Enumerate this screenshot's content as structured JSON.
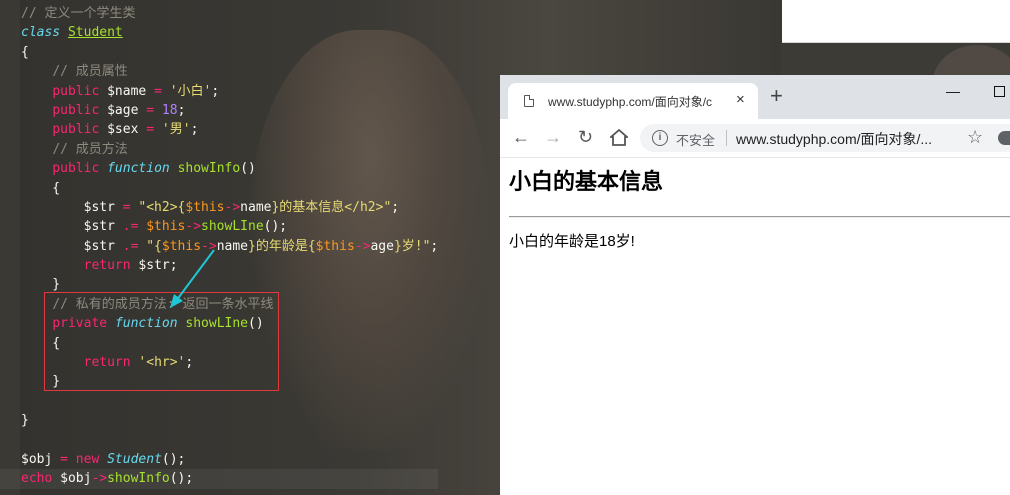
{
  "editor": {
    "lines": [
      [
        {
          "t": "// 定义一个学生类",
          "c": "c-com"
        }
      ],
      [
        {
          "t": "class",
          "c": "c-it"
        },
        {
          "t": " "
        },
        {
          "t": "Student",
          "c": "c-cls"
        }
      ],
      [
        {
          "t": "{"
        }
      ],
      [
        {
          "t": "    "
        },
        {
          "t": "// 成员属性",
          "c": "c-com"
        }
      ],
      [
        {
          "t": "    "
        },
        {
          "t": "public",
          "c": "c-kw"
        },
        {
          "t": " $name "
        },
        {
          "t": "=",
          "c": "c-op"
        },
        {
          "t": " "
        },
        {
          "t": "'小白'",
          "c": "c-str"
        },
        {
          "t": ";"
        }
      ],
      [
        {
          "t": "    "
        },
        {
          "t": "public",
          "c": "c-kw"
        },
        {
          "t": " $age "
        },
        {
          "t": "=",
          "c": "c-op"
        },
        {
          "t": " "
        },
        {
          "t": "18",
          "c": "c-num"
        },
        {
          "t": ";"
        }
      ],
      [
        {
          "t": "    "
        },
        {
          "t": "public",
          "c": "c-kw"
        },
        {
          "t": " $sex "
        },
        {
          "t": "=",
          "c": "c-op"
        },
        {
          "t": " "
        },
        {
          "t": "'男'",
          "c": "c-str"
        },
        {
          "t": ";"
        }
      ],
      [
        {
          "t": "    "
        },
        {
          "t": "// 成员方法",
          "c": "c-com"
        }
      ],
      [
        {
          "t": "    "
        },
        {
          "t": "public",
          "c": "c-kw"
        },
        {
          "t": " "
        },
        {
          "t": "function",
          "c": "c-it"
        },
        {
          "t": " "
        },
        {
          "t": "showInfo",
          "c": "c-fn"
        },
        {
          "t": "()"
        }
      ],
      [
        {
          "t": "    {"
        }
      ],
      [
        {
          "t": "        $str "
        },
        {
          "t": "=",
          "c": "c-op"
        },
        {
          "t": " "
        },
        {
          "t": "\"<h2>{",
          "c": "c-str"
        },
        {
          "t": "$this",
          "c": "c-th"
        },
        {
          "t": "->",
          "c": "c-op"
        },
        {
          "t": "name",
          "c": "c-prop"
        },
        {
          "t": "}的基本信息</h2>\"",
          "c": "c-str"
        },
        {
          "t": ";"
        }
      ],
      [
        {
          "t": "        $str "
        },
        {
          "t": ".=",
          "c": "c-op"
        },
        {
          "t": " "
        },
        {
          "t": "$this",
          "c": "c-th"
        },
        {
          "t": "->",
          "c": "c-op"
        },
        {
          "t": "showLIne",
          "c": "c-fn"
        },
        {
          "t": "();"
        }
      ],
      [
        {
          "t": "        $str "
        },
        {
          "t": ".=",
          "c": "c-op"
        },
        {
          "t": " "
        },
        {
          "t": "\"{",
          "c": "c-str"
        },
        {
          "t": "$this",
          "c": "c-th"
        },
        {
          "t": "->",
          "c": "c-op"
        },
        {
          "t": "name",
          "c": "c-prop"
        },
        {
          "t": "}的年龄是{",
          "c": "c-str"
        },
        {
          "t": "$this",
          "c": "c-th"
        },
        {
          "t": "->",
          "c": "c-op"
        },
        {
          "t": "age",
          "c": "c-prop"
        },
        {
          "t": "}岁!\"",
          "c": "c-str"
        },
        {
          "t": ";"
        }
      ],
      [
        {
          "t": "        "
        },
        {
          "t": "return",
          "c": "c-kw"
        },
        {
          "t": " $str;"
        }
      ],
      [
        {
          "t": "    }"
        }
      ],
      [
        {
          "t": "    "
        },
        {
          "t": "// 私有的成员方法: 返回一条水平线",
          "c": "c-com"
        }
      ],
      [
        {
          "t": "    "
        },
        {
          "t": "private",
          "c": "c-kw"
        },
        {
          "t": " "
        },
        {
          "t": "function",
          "c": "c-it"
        },
        {
          "t": " "
        },
        {
          "t": "showLIne",
          "c": "c-fn"
        },
        {
          "t": "()"
        }
      ],
      [
        {
          "t": "    {"
        }
      ],
      [
        {
          "t": "        "
        },
        {
          "t": "return",
          "c": "c-kw"
        },
        {
          "t": " "
        },
        {
          "t": "'<hr>'",
          "c": "c-str"
        },
        {
          "t": ";"
        }
      ],
      [
        {
          "t": "    }"
        }
      ],
      [
        {
          "t": ""
        }
      ],
      [
        {
          "t": "}"
        }
      ],
      [
        {
          "t": ""
        }
      ],
      [
        {
          "t": "$obj "
        },
        {
          "t": "=",
          "c": "c-op"
        },
        {
          "t": " "
        },
        {
          "t": "new",
          "c": "c-kw"
        },
        {
          "t": " "
        },
        {
          "t": "Student",
          "c": "c-it"
        },
        {
          "t": "();"
        }
      ],
      [
        {
          "t": "echo",
          "c": "c-kw"
        },
        {
          "t": " $obj"
        },
        {
          "t": "->",
          "c": "c-op"
        },
        {
          "t": "showInfo",
          "c": "c-fn"
        },
        {
          "t": "();"
        }
      ]
    ],
    "active_line": 24
  },
  "browser": {
    "tab_title": "www.studyphp.com/面向对象/c",
    "tab_close": "×",
    "new_tab": "+",
    "minimize": "—",
    "security_label": "不安全",
    "url": "www.studyphp.com/面向对象/...",
    "icons": {
      "back": "back-arrow-icon",
      "forward": "forward-arrow-icon",
      "reload": "reload-icon",
      "home": "home-icon",
      "info": "info-icon",
      "bookmark": "star-icon"
    },
    "page": {
      "heading": "小白的基本信息",
      "paragraph": "小白的年龄是18岁!"
    }
  },
  "colors": {
    "comment": "#8d8a7e",
    "keyword": "#f92672",
    "function": "#a6e22e",
    "string": "#e6db74",
    "number": "#ae81ff",
    "highlight_box": "#e0383c",
    "annotation_arrow": "#1fc6d6"
  }
}
